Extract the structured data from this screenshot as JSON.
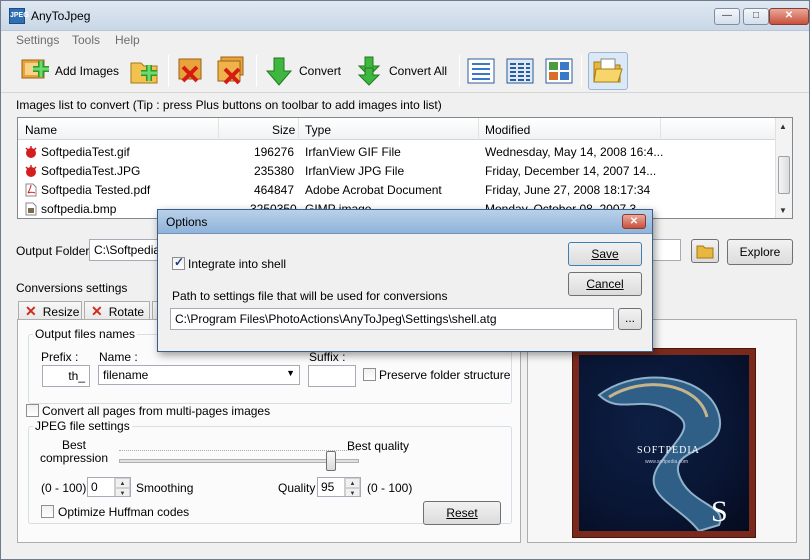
{
  "window": {
    "title": "AnyToJpeg",
    "app_icon": "JPEG",
    "minimize": "—",
    "maximize": "□",
    "close": "✕"
  },
  "menu": [
    "Settings",
    "Tools",
    "Help"
  ],
  "toolbar": {
    "add_images": "Add Images",
    "convert": "Convert",
    "convert_all": "Convert All"
  },
  "images_list": {
    "label": "Images list to convert   (Tip : press Plus buttons on toolbar to add images into list)",
    "columns": [
      "Name",
      "Size",
      "Type",
      "Modified"
    ],
    "rows": [
      {
        "name": "SoftpediaTest.gif",
        "size": "196276",
        "type": "IrfanView GIF File",
        "modified": "Wednesday, May 14, 2008 16:4...",
        "icon": "irfanview-icon"
      },
      {
        "name": "SoftpediaTest.JPG",
        "size": "235380",
        "type": "IrfanView JPG File",
        "modified": "Friday, December 14, 2007 14...",
        "icon": "irfanview-icon"
      },
      {
        "name": "Softpedia Tested.pdf",
        "size": "464847",
        "type": "Adobe Acrobat Document",
        "modified": "Friday, June 27, 2008 18:17:34",
        "icon": "pdf-icon"
      },
      {
        "name": "softpedia.bmp",
        "size": "3250350",
        "type": "GIMP image",
        "modified": "Monday, October 08, 2007 3...",
        "icon": "gimp-icon"
      }
    ]
  },
  "output": {
    "label": "Output Folder",
    "value": "C:\\Softpedia",
    "explore": "Explore"
  },
  "conversions": {
    "label": "Conversions settings",
    "tabs": [
      "Resize",
      "Rotate"
    ],
    "output_names": {
      "group_label": "Output files names",
      "prefix_label": "Prefix :",
      "prefix_value": "th_",
      "name_label": "Name :",
      "name_value": "filename",
      "suffix_label": "Suffix :",
      "suffix_value": "",
      "preserve": "Preserve folder structure"
    },
    "convert_pages": "Convert all pages from multi-pages images",
    "jpeg": {
      "group_label": "JPEG file settings",
      "best_compression": "Best compression",
      "best_quality": "Best quality",
      "quality_slider": 0.9,
      "range1": "(0 - 100)",
      "smoothing_value": "0",
      "smoothing_label": "Smoothing",
      "quality_label": "Quality",
      "quality_value": "95",
      "range2": "(0 - 100)",
      "huffman": "Optimize Huffman codes",
      "reset": "Reset"
    }
  },
  "preview": {
    "caption": "SOFTPEDIA",
    "url": "www.softpedia.com",
    "logo": "S"
  },
  "dialog": {
    "title": "Options",
    "integrate": "Integrate into shell",
    "integrate_checked": true,
    "path_label": "Path to settings file that will be used for conversions",
    "path_value": "C:\\Program Files\\PhotoActions\\AnyToJpeg\\Settings\\shell.atg",
    "browse": "...",
    "save": "Save",
    "cancel": "Cancel"
  }
}
